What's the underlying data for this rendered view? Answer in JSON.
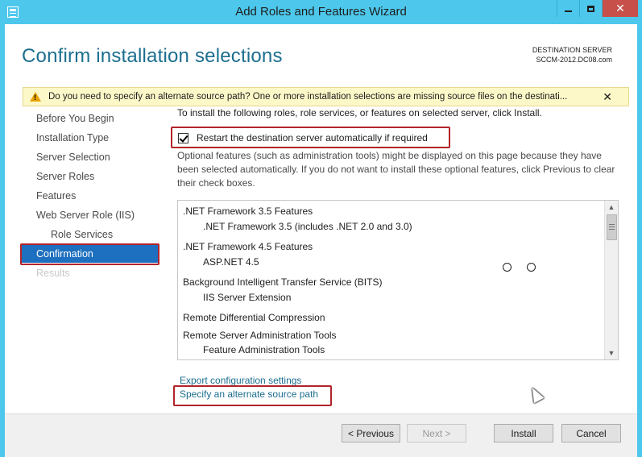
{
  "window": {
    "title": "Add Roles and Features Wizard",
    "close_glyph": "✕",
    "accent_color": "#4dc8ec"
  },
  "header": {
    "title": "Confirm installation selections",
    "destination_label": "DESTINATION SERVER",
    "destination_server": "SCCM-2012.DC08.com"
  },
  "warning": {
    "icon": "warning-triangle-icon",
    "text": "Do you need to specify an alternate source path? One or more installation selections are missing source files on the destinati...",
    "close_glyph": "✕"
  },
  "sidebar": {
    "items": [
      {
        "label": "Before You Begin",
        "state": "normal"
      },
      {
        "label": "Installation Type",
        "state": "normal"
      },
      {
        "label": "Server Selection",
        "state": "normal"
      },
      {
        "label": "Server Roles",
        "state": "normal"
      },
      {
        "label": "Features",
        "state": "normal"
      },
      {
        "label": "Web Server Role (IIS)",
        "state": "normal"
      },
      {
        "label": "Role Services",
        "state": "normal",
        "sub": true
      },
      {
        "label": "Confirmation",
        "state": "active"
      },
      {
        "label": "Results",
        "state": "disabled"
      }
    ]
  },
  "main": {
    "intro": "To install the following roles, role services, or features on selected server, click Install.",
    "restart_checkbox": {
      "label": "Restart the destination server automatically if required",
      "checked": true
    },
    "optional_note": "Optional features (such as administration tools) might be displayed on this page because they have been selected automatically. If you do not want to install these optional features, click Previous to clear their check boxes.",
    "features": [
      {
        "label": ".NET Framework 3.5 Features",
        "level": 0
      },
      {
        "label": ".NET Framework 3.5 (includes .NET 2.0 and 3.0)",
        "level": 1
      },
      {
        "label": ".NET Framework 4.5 Features",
        "level": 0
      },
      {
        "label": "ASP.NET 4.5",
        "level": 1
      },
      {
        "label": "Background Intelligent Transfer Service (BITS)",
        "level": 0
      },
      {
        "label": "IIS Server Extension",
        "level": 1
      },
      {
        "label": "Remote Differential Compression",
        "level": 0
      },
      {
        "label": "Remote Server Administration Tools",
        "level": 0
      },
      {
        "label": "Feature Administration Tools",
        "level": 1
      }
    ],
    "links": {
      "export": "Export configuration settings",
      "alternate_source": "Specify an alternate source path"
    }
  },
  "footer": {
    "previous": "< Previous",
    "next": "Next >",
    "install": "Install",
    "cancel": "Cancel"
  }
}
